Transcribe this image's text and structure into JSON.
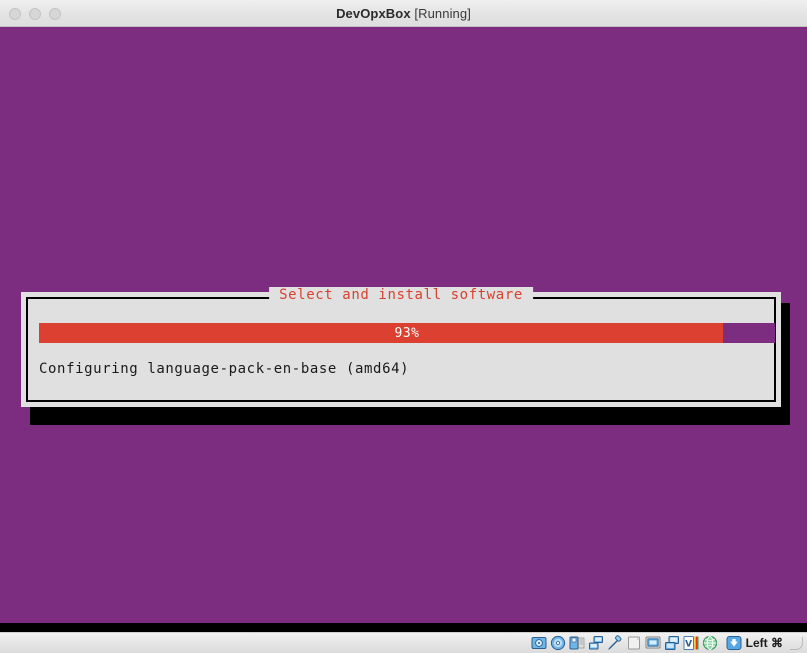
{
  "window": {
    "app_name": "DevOpxBox",
    "run_state": "[Running]",
    "traffic_lights": [
      "close",
      "minimize",
      "zoom"
    ]
  },
  "colors": {
    "guest_background": "#7c2d80",
    "dialog_background": "#e0e0e0",
    "dialog_border": "#000000",
    "title_text": "#d9412f",
    "progress_fill": "#dc4030",
    "progress_track": "#7c2d80",
    "status_text": "#1a1a1a",
    "titlebar_background": "#e4e4e4",
    "statusbar_background": "#e6e6e6"
  },
  "dialog": {
    "title": "Select and install software",
    "progress": {
      "percent_label": "93%",
      "percent_value": 93
    },
    "status_text": "Configuring language-pack-en-base (amd64)"
  },
  "statusbar": {
    "icons": [
      {
        "name": "hard-disk-icon",
        "title": "Hard Disks"
      },
      {
        "name": "optical-drive-icon",
        "title": "Optical Drives"
      },
      {
        "name": "floppy-drive-icon",
        "title": "Floppy Drives"
      },
      {
        "name": "network-icon",
        "title": "Network"
      },
      {
        "name": "usb-icon",
        "title": "USB Devices"
      },
      {
        "name": "shared-folders-icon",
        "title": "Shared Folders"
      },
      {
        "name": "display-icon",
        "title": "Display"
      },
      {
        "name": "recording-icon",
        "title": "Recording"
      },
      {
        "name": "vm-features-icon",
        "title": "VM Features"
      },
      {
        "name": "globe-icon",
        "title": "Mouse Integration"
      },
      {
        "name": "host-key-arrow-icon",
        "title": "Host Key"
      }
    ],
    "host_key_label": "Left ⌘"
  }
}
